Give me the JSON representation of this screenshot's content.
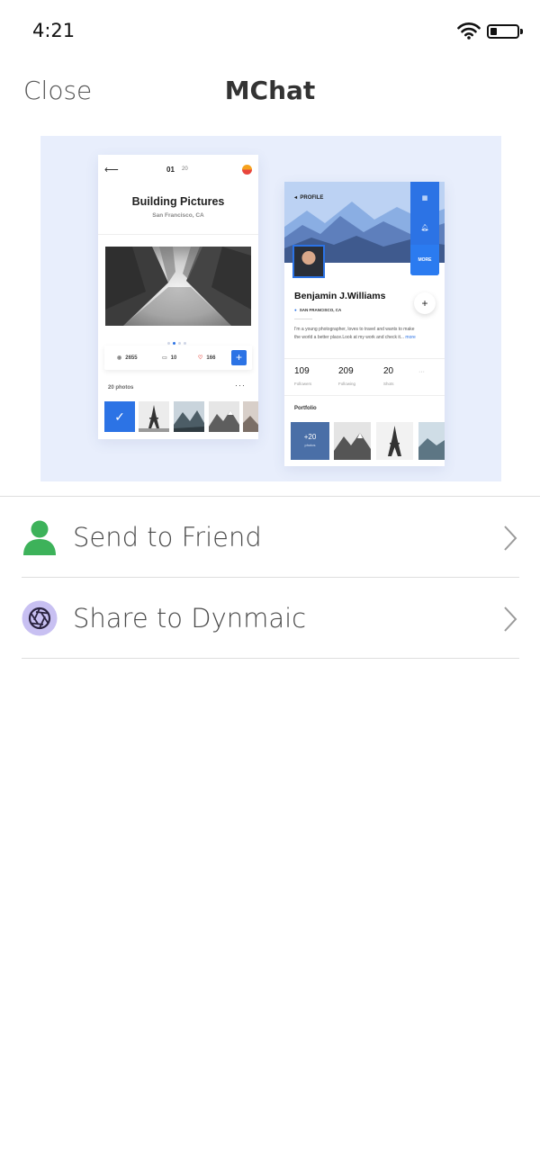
{
  "status_bar": {
    "time": "4:21",
    "battery_level": 0.25
  },
  "nav": {
    "close_label": "Close",
    "title": "MChat"
  },
  "preview": {
    "left_card": {
      "back_icon": "arrow-left-icon",
      "page_current": "01",
      "page_total": "20",
      "title": "Building Pictures",
      "subtitle": "San Francisco, CA",
      "stats": {
        "views": "2655",
        "comments": "10",
        "likes": "166"
      },
      "add_label": "+",
      "photos_label": "20 photos",
      "more_label": "···"
    },
    "right_card": {
      "back_label": "PROFILE",
      "menu_more_label": "MORE",
      "name": "Benjamin J.Williams",
      "location": "SAN FRANCISCO, CA",
      "bio_text": "I'm a young photographer, loves to travel and wants to make the world a better place.Look at my work and check it...",
      "bio_more": "more",
      "stats": [
        {
          "value": "109",
          "label": "Followers"
        },
        {
          "value": "209",
          "label": "Following"
        },
        {
          "value": "20",
          "label": "Shots"
        }
      ],
      "portfolio_label": "Portfolio",
      "portfolio_more_count": "+20",
      "portfolio_more_label": "photos"
    }
  },
  "options": [
    {
      "label": "Send to Friend",
      "icon": "person-icon",
      "color": "#3db25a"
    },
    {
      "label": "Share to Dynmaic",
      "icon": "shutter-icon",
      "color": "#c8c0f2"
    }
  ],
  "colors": {
    "accent_blue": "#2c73e5",
    "preview_bg": "#e8eefc"
  }
}
